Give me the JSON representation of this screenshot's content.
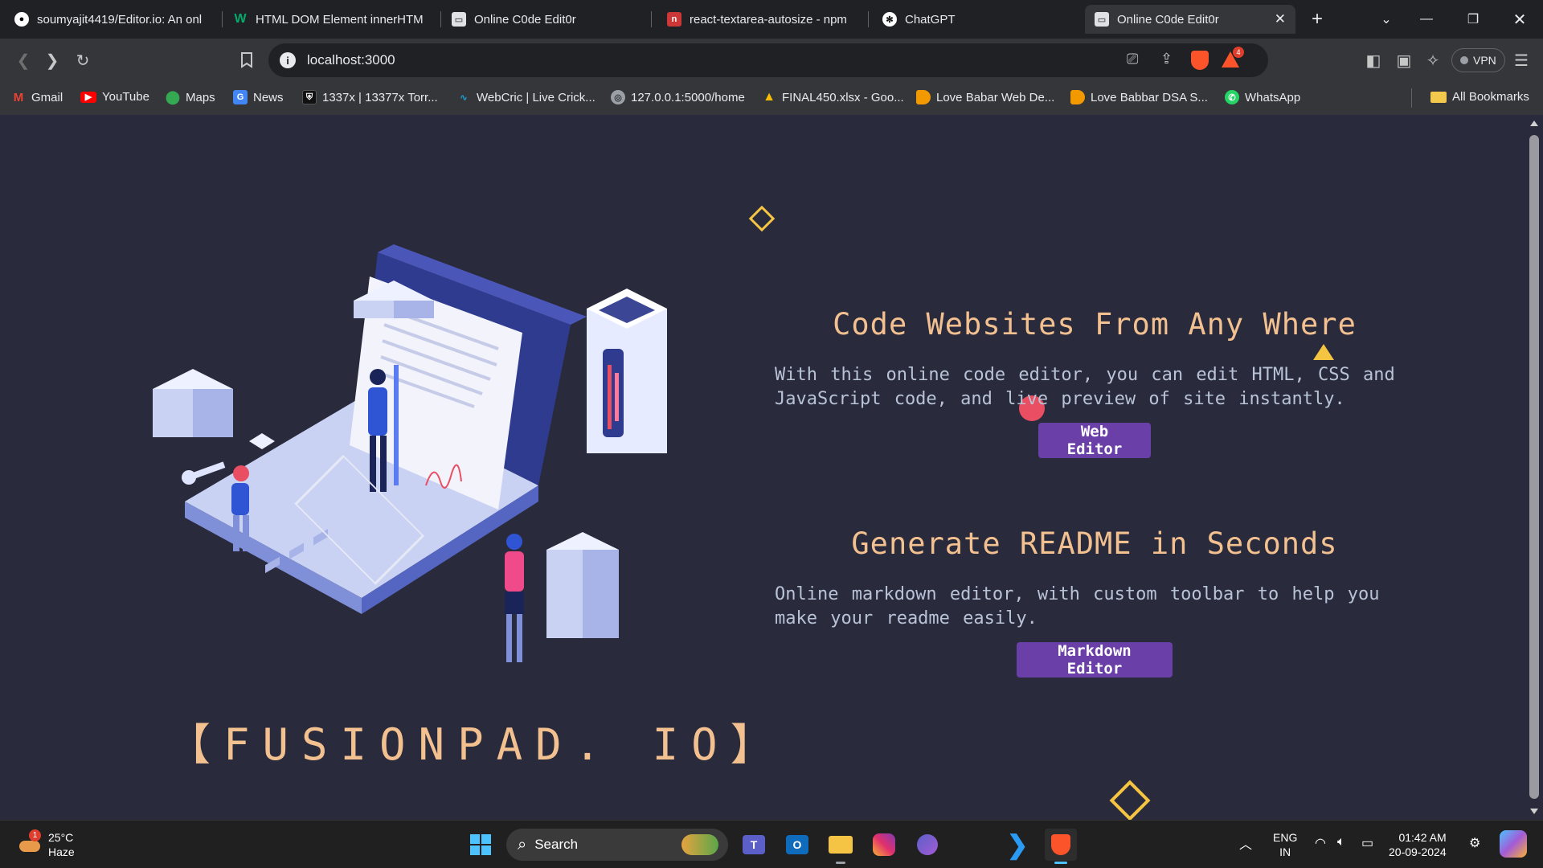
{
  "tabs": [
    {
      "title": "soumyajit4419/Editor.io: An onl",
      "icon": "github-icon"
    },
    {
      "title": "HTML DOM Element innerHTM",
      "icon": "w3schools-icon"
    },
    {
      "title": "Online C0de Edit0r",
      "icon": "page-icon"
    },
    {
      "title": "react-textarea-autosize - npm",
      "icon": "npm-icon"
    },
    {
      "title": "ChatGPT",
      "icon": "chatgpt-icon"
    },
    {
      "title": "Online C0de Edit0r",
      "icon": "page-icon",
      "active": true
    }
  ],
  "new_tab": "+",
  "address": {
    "url": "localhost:3000"
  },
  "shield_badge": "4",
  "vpn_label": "VPN",
  "bookmarks": [
    {
      "label": "Gmail",
      "icon": "gmail-icon",
      "color": "#ea4335"
    },
    {
      "label": "YouTube",
      "icon": "youtube-icon",
      "color": "#ff0000"
    },
    {
      "label": "Maps",
      "icon": "maps-icon",
      "color": "#34a853"
    },
    {
      "label": "News",
      "icon": "news-icon",
      "color": "#4285f4"
    },
    {
      "label": "1337x | 13377x Torr...",
      "icon": "shield-icon",
      "color": "#111111"
    },
    {
      "label": "WebCric | Live Crick...",
      "icon": "webcric-icon",
      "color": "#1ca0d8"
    },
    {
      "label": "127.0.0.1:5000/home",
      "icon": "globe-icon",
      "color": "#9aa0a6"
    },
    {
      "label": "FINAL450.xlsx - Goo...",
      "icon": "drive-icon",
      "color": "#fbbc04"
    },
    {
      "label": "Love Babar Web De...",
      "icon": "bookmark-icon",
      "color": "#f29900"
    },
    {
      "label": "Love Babbar DSA S...",
      "icon": "bookmark-icon",
      "color": "#f29900"
    },
    {
      "label": "WhatsApp",
      "icon": "whatsapp-icon",
      "color": "#25d366"
    }
  ],
  "all_bookmarks": "All Bookmarks",
  "hero": {
    "section1": {
      "title": "Code Websites From Any Where",
      "text_line1": "With this online code editor, you can edit HTML, CSS and",
      "text_line2": "JavaScript code, and live preview of site instantly.",
      "button": "Web Editor"
    },
    "section2": {
      "title": "Generate README in Seconds",
      "text_line1": "Online markdown editor, with custom toolbar to help you",
      "text_line2": "make your readme easily.",
      "button": "Markdown Editor"
    },
    "logo": "【FUSIONPAD. IO】"
  },
  "colors": {
    "accent": "#f3c08f",
    "button": "#6a3fa8",
    "background": "#2a2a3d",
    "body_text": "#b9c3d6"
  },
  "taskbar": {
    "weather": {
      "temp": "25°C",
      "condition": "Haze",
      "badge": "1"
    },
    "search": "Search",
    "lang_top": "ENG",
    "lang_bottom": "IN",
    "time": "01:42 AM",
    "date": "20-09-2024"
  }
}
